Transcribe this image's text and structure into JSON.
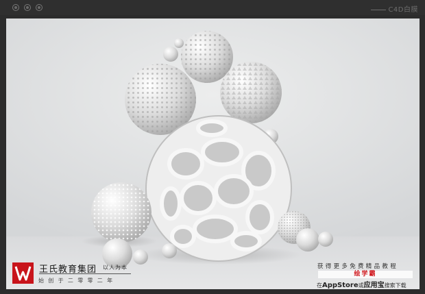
{
  "window": {
    "title": "C4D白膜",
    "controls": [
      "close-icon",
      "minimize-icon",
      "zoom-icon"
    ]
  },
  "company": {
    "name": "王氏教育集团",
    "motto": "以人为本",
    "founded": "始创于二零零二年",
    "logo_letter": "W"
  },
  "promo": {
    "headline": "获得更多免费精品教程",
    "brand": "绘学霸",
    "store_prefix": "在",
    "store_name": "AppStore",
    "store_or": "或",
    "alt_store": "应用宝",
    "store_suffix": "搜索下载"
  },
  "colors": {
    "frame": "#2c2c2c",
    "background": "#e1e2e4",
    "logo_red": "#c8141b",
    "brand_red": "#d0161c"
  }
}
